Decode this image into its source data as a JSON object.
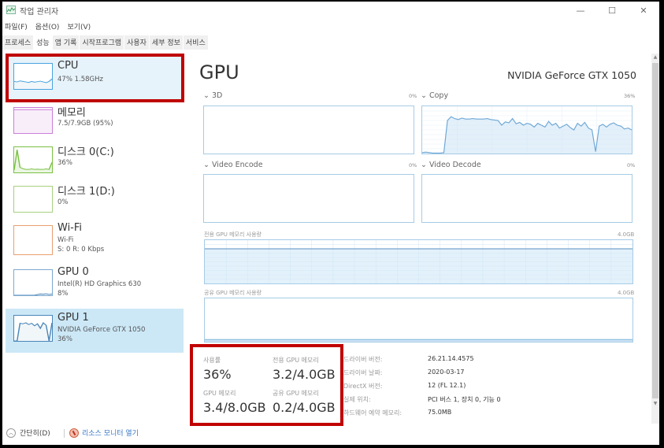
{
  "window": {
    "title": "작업 관리자",
    "minimize_label": "—",
    "maximize_label": "☐",
    "close_label": "✕"
  },
  "menu": [
    "파일(F)",
    "옵션(O)",
    "보기(V)"
  ],
  "tabs": [
    {
      "label": "프로세스",
      "active": false
    },
    {
      "label": "성능",
      "active": true
    },
    {
      "label": "앱 기록",
      "active": false
    },
    {
      "label": "시작프로그램",
      "active": false
    },
    {
      "label": "사용자",
      "active": false
    },
    {
      "label": "세부 정보",
      "active": false
    },
    {
      "label": "서비스",
      "active": false
    }
  ],
  "sidebar": {
    "items": [
      {
        "name": "CPU",
        "sub1": "47% 1.58GHz",
        "sub2": "",
        "color": "#4aa3df",
        "state": "hover"
      },
      {
        "name": "메모리",
        "sub1": "7.5/7.9GB (95%)",
        "sub2": "",
        "color": "#c97fd6",
        "state": ""
      },
      {
        "name": "디스크 0(C:)",
        "sub1": "36%",
        "sub2": "",
        "color": "#7ac143",
        "state": ""
      },
      {
        "name": "디스크 1(D:)",
        "sub1": "0%",
        "sub2": "",
        "color": "#a8d080",
        "state": ""
      },
      {
        "name": "Wi-Fi",
        "sub1": "Wi-Fi",
        "sub2": "S: 0 R: 0 Kbps",
        "color": "#e8a070",
        "state": ""
      },
      {
        "name": "GPU 0",
        "sub1": "Intel(R) HD Graphics 630",
        "sub2": "8%",
        "color": "#4a86b8",
        "state": ""
      },
      {
        "name": "GPU 1",
        "sub1": "NVIDIA GeForce GTX 1050",
        "sub2": "36%",
        "color": "#4a86b8",
        "state": "selected"
      }
    ]
  },
  "main": {
    "title": "GPU",
    "model": "NVIDIA GeForce GTX 1050",
    "engines": [
      {
        "label": "3D",
        "pct": "0%"
      },
      {
        "label": "Copy",
        "pct": "36%"
      },
      {
        "label": "Video Encode",
        "pct": "0%"
      },
      {
        "label": "Video Decode",
        "pct": "0%"
      }
    ],
    "dedicated_mem_label": "전용 GPU 메모리 사용량",
    "dedicated_mem_max": "4.0GB",
    "dedicated_mem_fraction": 0.8,
    "shared_mem_label": "공유 GPU 메모리 사용량",
    "shared_mem_max": "4.0GB",
    "shared_mem_fraction": 0.05,
    "stats": {
      "usage_label": "사용률",
      "usage_value": "36%",
      "dedicated_label": "전용 GPU 메모리",
      "dedicated_value": "3.2/4.0GB",
      "gpu_mem_label": "GPU 메모리",
      "gpu_mem_value": "3.4/8.0GB",
      "shared_label": "공유 GPU 메모리",
      "shared_value": "0.2/4.0GB"
    },
    "info": [
      {
        "label": "드라이버 버전:",
        "value": "26.21.14.4575"
      },
      {
        "label": "드라이버 날짜:",
        "value": "2020-03-17"
      },
      {
        "label": "DirectX 버전:",
        "value": "12 (FL 12.1)"
      },
      {
        "label": "실제 위치:",
        "value": "PCI 버스 1, 장치 0, 기능 0"
      },
      {
        "label": "하드웨어 예약 메모리:",
        "value": "75.0MB"
      }
    ]
  },
  "copy_series": [
    2,
    3,
    2,
    1,
    1,
    1,
    2,
    70,
    78,
    74,
    72,
    75,
    73,
    73,
    74,
    73,
    73,
    73,
    74,
    72,
    71,
    70,
    60,
    67,
    65,
    74,
    63,
    66,
    60,
    64,
    62,
    56,
    64,
    60,
    56,
    68,
    60,
    64,
    54,
    58,
    62,
    55,
    50,
    64,
    58,
    66,
    54,
    50,
    4,
    58,
    62,
    56,
    62,
    65,
    60,
    58,
    52,
    54,
    50
  ],
  "thumbs": {
    "cpu": [
      30,
      28,
      32,
      30,
      28,
      26,
      30,
      27,
      29,
      31,
      28,
      25,
      30,
      40
    ],
    "disk0": [
      10,
      90,
      20,
      15,
      12,
      12,
      14,
      12,
      13,
      12,
      12,
      14,
      12,
      40
    ],
    "gpu0": [
      0,
      0,
      0,
      0,
      0,
      0,
      0,
      0,
      3,
      5,
      4,
      6,
      3,
      5
    ],
    "gpu1": [
      0,
      0,
      70,
      68,
      72,
      65,
      70,
      60,
      68,
      50,
      72,
      62,
      0,
      72
    ]
  },
  "footer": {
    "collapse_label": "간단히(D)",
    "resource_monitor_label": "리소스 모니터 열기"
  }
}
